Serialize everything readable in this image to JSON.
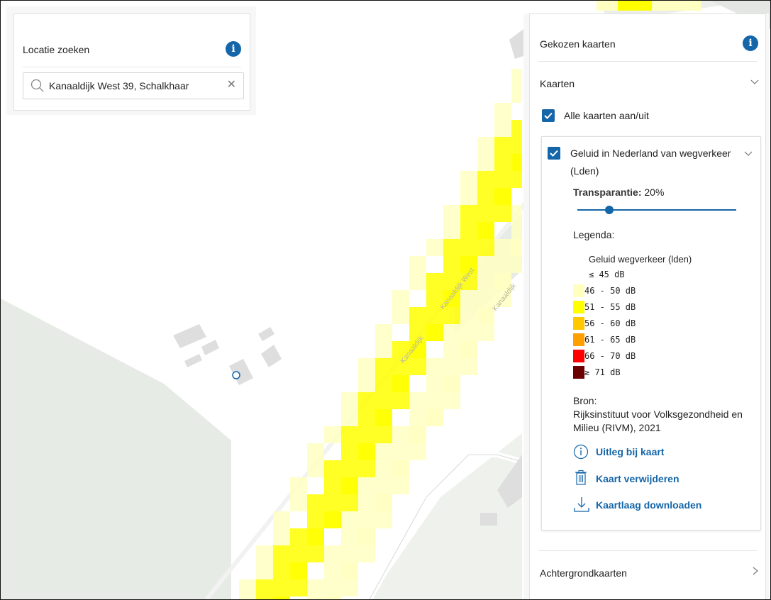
{
  "search": {
    "title": "Locatie zoeken",
    "value": "Kanaaldijk West 39, Schalkhaar",
    "clear_icon": "close-icon",
    "search_icon": "search-icon"
  },
  "layers": {
    "title": "Gekozen kaarten",
    "section_maps": "Kaarten",
    "toggle_all": "Alle kaarten aan/uit",
    "toggle_all_checked": true,
    "layer": {
      "name_line1": "Geluid in Nederland van wegverkeer",
      "name_line2": "(Lden)",
      "checked": true,
      "transparency_label": "Transparantie:",
      "transparency_value": "20%",
      "transparency_fraction": 0.2,
      "legend_title": "Legenda:",
      "legend_header": "Geluid wegverkeer (lden)",
      "legend_items": [
        {
          "label": "≤ 45 dB",
          "color": "#ffffff"
        },
        {
          "label": "46 - 50 dB",
          "color": "#ffffc0"
        },
        {
          "label": "51 - 55 dB",
          "color": "#ffff00"
        },
        {
          "label": "56 - 60 dB",
          "color": "#ffc800"
        },
        {
          "label": "61 - 65 dB",
          "color": "#ffa000"
        },
        {
          "label": "66 - 70 dB",
          "color": "#ff0000"
        },
        {
          "label": "≥ 71 dB",
          "color": "#6b0000"
        }
      ],
      "source_label": "Bron:",
      "source_line1": "Rijksinstituut voor Volksgezondheid en",
      "source_line2": "Milieu (RIVM), 2021",
      "actions": [
        {
          "label": "Uitleg bij kaart",
          "icon": "info-circle-icon"
        },
        {
          "label": "Kaart verwijderen",
          "icon": "trash-icon"
        },
        {
          "label": "Kaartlaag downloaden",
          "icon": "download-icon"
        }
      ]
    },
    "section_background": "Achtergrondkaarten"
  },
  "map": {
    "road_labels": [
      "Kanaaldijk",
      "Kanaaldijk West",
      "Kanaaldijk"
    ],
    "colors": {
      "light": "#ffffc2",
      "yellow": "#ffff00",
      "land": "#e7ebe6",
      "building": "#dcdcdc"
    }
  }
}
